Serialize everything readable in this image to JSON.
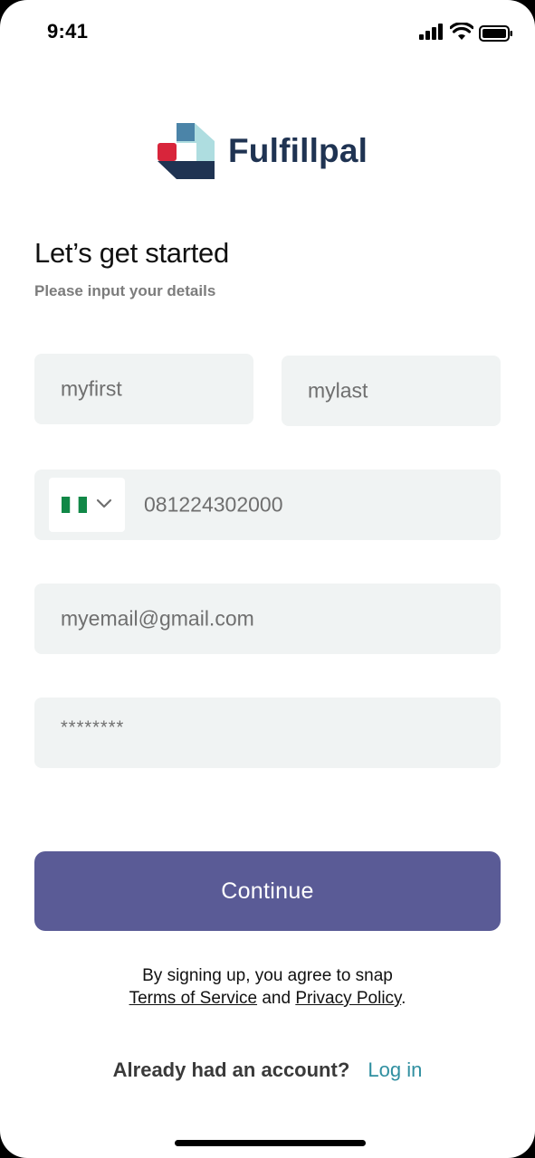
{
  "status_bar": {
    "time": "9:41",
    "icons": [
      "signal-icon",
      "wifi-icon",
      "battery-icon"
    ]
  },
  "brand": {
    "name": "Fulfillpal",
    "colors": {
      "navy": "#1f3352",
      "red": "#d8253b",
      "teal": "#aedde0",
      "blue": "#4b84a8"
    }
  },
  "header": {
    "title": "Let’s get started",
    "subtitle": "Please input your details"
  },
  "form": {
    "first_name": {
      "value": "myfirst"
    },
    "last_name": {
      "value": "mylast"
    },
    "phone": {
      "country_flag": "nigeria-flag-icon",
      "value": "081224302000"
    },
    "email": {
      "value": "myemail@gmail.com"
    },
    "password": {
      "value": "********"
    }
  },
  "actions": {
    "continue_label": "Continue",
    "accent": "#5a5b96"
  },
  "legal": {
    "line1": "By signing up, you agree to snap",
    "terms_link": "Terms of Service",
    "and": "and",
    "privacy_link": "Privacy Policy",
    "end": "."
  },
  "login": {
    "prompt": "Already had an account?",
    "link": "Log in"
  }
}
